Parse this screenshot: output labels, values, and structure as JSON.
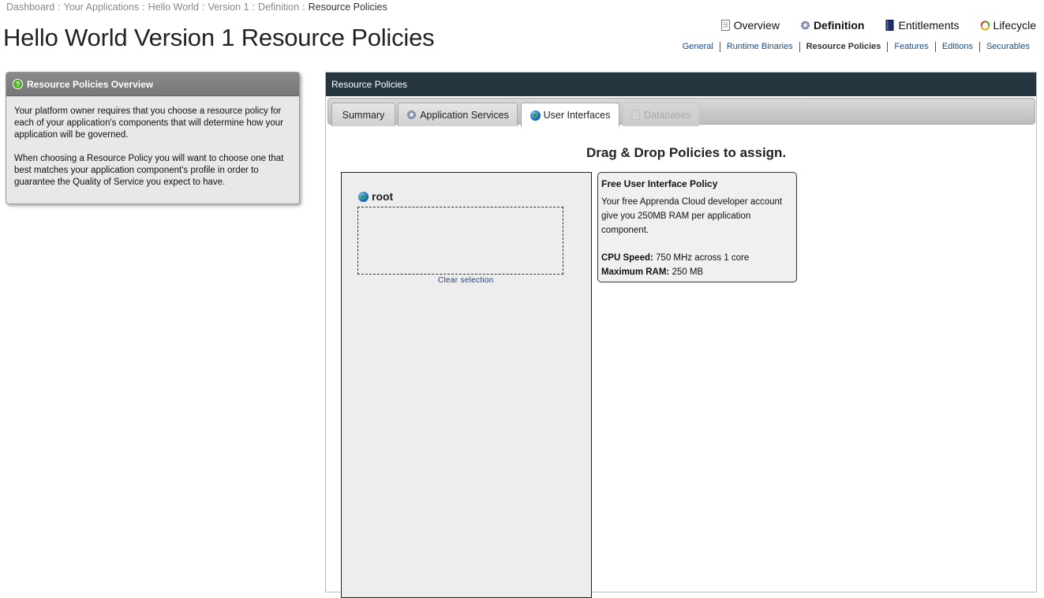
{
  "breadcrumb": [
    {
      "label": "Dashboard"
    },
    {
      "label": "Your Applications"
    },
    {
      "label": "Hello World"
    },
    {
      "label": "Version 1"
    },
    {
      "label": "Definition"
    },
    {
      "label": "Resource Policies"
    }
  ],
  "breadcrumb_separator": ":",
  "page_title": "Hello World Version 1 Resource Policies",
  "main_nav": [
    {
      "label": "Overview",
      "icon": "document-icon"
    },
    {
      "label": "Definition",
      "icon": "gear-icon",
      "active": true
    },
    {
      "label": "Entitlements",
      "icon": "book-icon"
    },
    {
      "label": "Lifecycle",
      "icon": "recycle-icon"
    }
  ],
  "sub_nav": [
    {
      "label": "General"
    },
    {
      "label": "Runtime Binaries"
    },
    {
      "label": "Resource Policies",
      "active": true
    },
    {
      "label": "Features"
    },
    {
      "label": "Editions"
    },
    {
      "label": "Securables"
    }
  ],
  "overview_panel": {
    "title": "Resource Policies Overview",
    "paragraphs": [
      "Your platform owner requires that you choose a resource policy for each of your application's components that will determine how your application will be governed.",
      "When choosing a Resource Policy you will want to choose one that best matches your application component's profile in order to guarantee the Quality of Service you expect to have."
    ]
  },
  "policies_panel": {
    "title": "Resource Policies",
    "tabs": [
      {
        "label": "Summary"
      },
      {
        "label": "Application Services",
        "icon": "gear-icon"
      },
      {
        "label": "User Interfaces",
        "icon": "globe-icon",
        "active": true
      },
      {
        "label": "Databases",
        "icon": "database-icon",
        "disabled": true
      }
    ],
    "drag_heading": "Drag & Drop Policies to assign.",
    "component": {
      "name": "root",
      "clear_label": "Clear selection"
    },
    "policy": {
      "title": "Free User Interface Policy",
      "description": "Your free Apprenda Cloud developer account give you 250MB RAM per application component.",
      "cpu_label": "CPU Speed:",
      "cpu_value": "750 MHz across 1 core",
      "ram_label": "Maximum RAM:",
      "ram_value": "250 MB"
    }
  },
  "colors": {
    "panel_header": "#253640",
    "link": "#1f4a87",
    "overview_header": "#808080"
  }
}
